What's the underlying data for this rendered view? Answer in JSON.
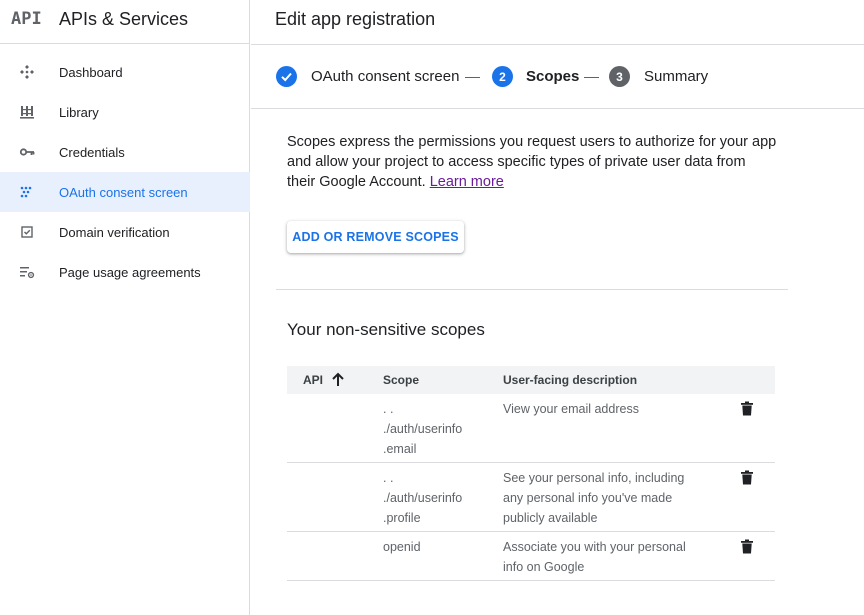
{
  "app": {
    "logo": "API",
    "title": "APIs & Services"
  },
  "sidebar": {
    "items": [
      {
        "label": "Dashboard",
        "icon": "dashboard-icon"
      },
      {
        "label": "Library",
        "icon": "library-icon"
      },
      {
        "label": "Credentials",
        "icon": "key-icon"
      },
      {
        "label": "OAuth consent screen",
        "icon": "oauth-icon",
        "active": true
      },
      {
        "label": "Domain verification",
        "icon": "checkbox-icon"
      },
      {
        "label": "Page usage agreements",
        "icon": "settings-list-icon"
      }
    ]
  },
  "main": {
    "title": "Edit app registration",
    "steps": [
      {
        "label": "OAuth consent screen",
        "state": "complete"
      },
      {
        "number": "2",
        "label": "Scopes",
        "state": "current"
      },
      {
        "number": "3",
        "label": "Summary",
        "state": "upcoming"
      }
    ],
    "intro_text": "Scopes express the permissions you request users to authorize for your app and allow your project to access specific types of private user data from their Google Account.",
    "learn_more": "Learn more",
    "add_scopes_button": "ADD OR REMOVE SCOPES",
    "section_title": "Your non-sensitive scopes",
    "table": {
      "headers": {
        "api": "API",
        "scope": "Scope",
        "description": "User-facing description"
      },
      "rows": [
        {
          "api": "",
          "scope": [
            ". .",
            "./auth/userinfo",
            ".email"
          ],
          "description": "View your email address"
        },
        {
          "api": "",
          "scope": [
            ". .",
            "./auth/userinfo",
            ".profile"
          ],
          "description": "See your personal info, including any personal info you've made publicly available"
        },
        {
          "api": "",
          "scope": [
            "openid"
          ],
          "description": "Associate you with your personal info on Google"
        }
      ]
    }
  },
  "colors": {
    "accent": "#1a73e8",
    "step_complete": "#1a73e8",
    "step_upcoming": "#5f6368",
    "link": "#6a1b9a",
    "active_bg": "#e8f0fe"
  }
}
